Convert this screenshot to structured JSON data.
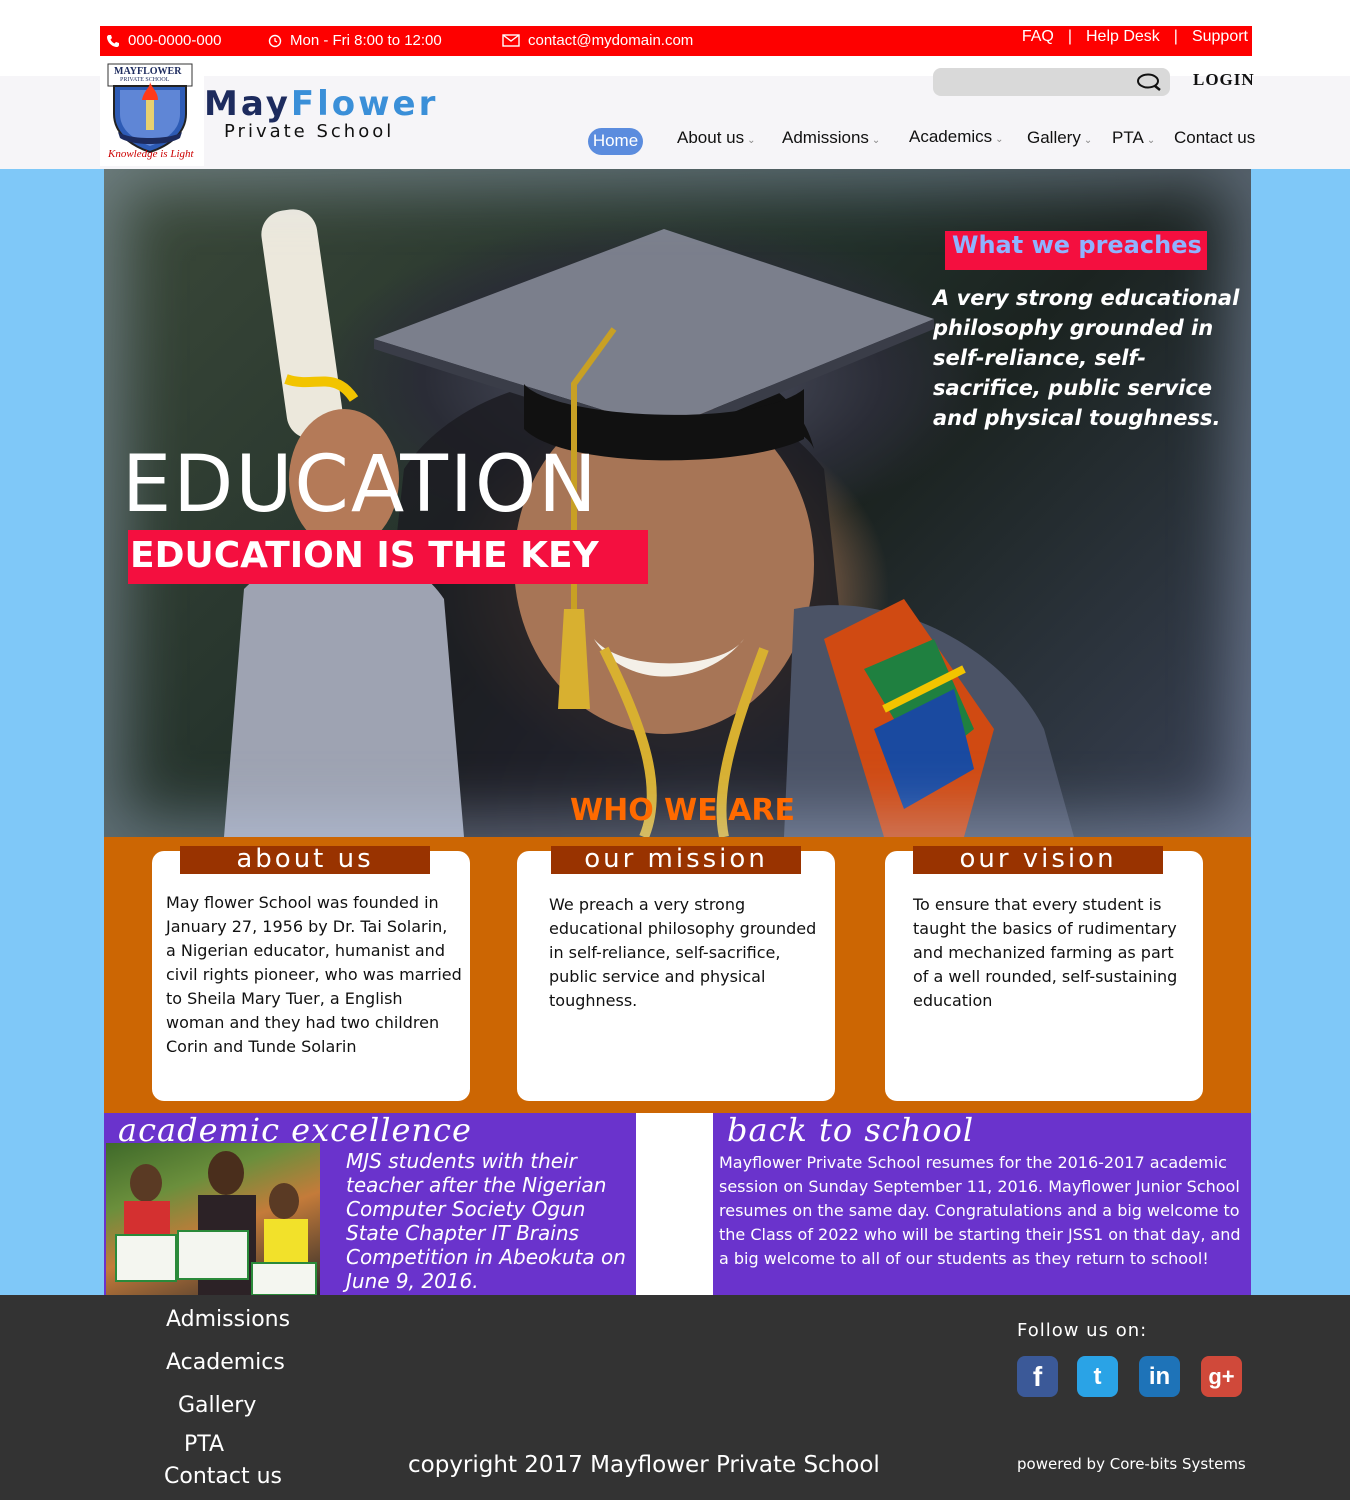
{
  "topbar": {
    "phone": "000-0000-000",
    "hours": "Mon - Fri 8:00 to 12:00",
    "email": "contact@mydomain.com",
    "links": [
      "FAQ",
      "|",
      "Help Desk",
      "|",
      "Support"
    ]
  },
  "brand": {
    "logo_text": "MAYFLOWER",
    "logo_subtext": "PRIVATE SCHOOL",
    "motto": "Knowledge is Light",
    "name_part1": "May",
    "name_part2": "Flower",
    "subtitle": "Private School"
  },
  "header": {
    "login": "LOGIN",
    "nav": {
      "home": "Home",
      "about": "About us",
      "admissions": "Admissions",
      "academics": "Academics",
      "gallery": "Gallery",
      "pta": "PTA",
      "contact": "Contact us"
    }
  },
  "hero": {
    "preach_title": "What we  preaches",
    "philosophy": "A very strong educational philosophy grounded in self-reliance, self-sacrifice, public service and physical toughness.",
    "headline": "EDUCATION",
    "tagline": "EDUCATION IS THE KEY",
    "section_title": "WHO WE ARE"
  },
  "cards": {
    "about": {
      "title": "about us",
      "text": "May flower School was founded in January 27, 1956 by Dr. Tai Solarin, a Nigerian educator, humanist and civil rights pioneer, who was married to Sheila Mary Tuer, a English woman and they had two children Corin and Tunde Solarin"
    },
    "mission": {
      "title": "our mission",
      "text": "We preach a very strong educational philosophy grounded in self-reliance, self-sacrifice, public service and physical toughness."
    },
    "vision": {
      "title": "our vision",
      "text": "To ensure that every student is taught the basics of rudimentary and mechanized farming as part of a well rounded, self-sustaining education"
    }
  },
  "academic": {
    "title": "academic excellence",
    "caption": "MJS students with their teacher after the Nigerian Computer Society Ogun State Chapter IT Brains Competition in Abeokuta on June 9, 2016."
  },
  "back_to_school": {
    "title": "back to school",
    "text": "Mayflower Private School resumes for the 2016-2017 academic session on Sunday September 11, 2016. Mayflower Junior School resumes on the same day. Congratulations and a big welcome to the Class of 2022 who will be starting their JSS1 on that day, and a big welcome to all of our students as they return to school!"
  },
  "footer": {
    "links": {
      "admissions": "Admissions",
      "academics": "Academics",
      "gallery": "Gallery",
      "pta": "PTA",
      "contact": "Contact us"
    },
    "copyright": "copyright 2017 Mayflower Private School",
    "follow": "Follow us on:",
    "social": {
      "facebook": "f",
      "twitter": "t",
      "linkedin": "in",
      "googleplus": "g+"
    },
    "powered": "powered by Core-bits Systems"
  },
  "colors": {
    "accent_red": "#fe0000",
    "tag_red": "#f40f3f",
    "orange": "#cc6603",
    "purple": "#6a33cc",
    "sky": "#7fc8f8",
    "footer": "#333333"
  }
}
